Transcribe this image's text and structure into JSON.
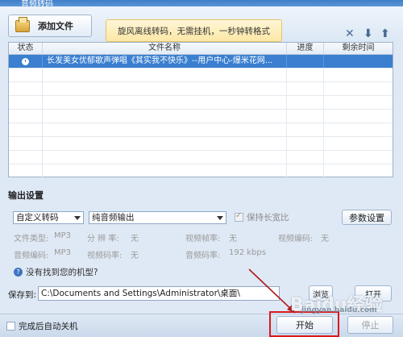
{
  "window": {
    "title": "音频转码"
  },
  "toolbar": {
    "add_file_label": "添加文件",
    "promo_text": "旋风离线转码，无需挂机，一秒钟转格式",
    "icons": [
      "close-icon",
      "move-down-icon",
      "move-up-icon"
    ]
  },
  "grid": {
    "headers": {
      "status": "状态",
      "file_name": "文件名称",
      "progress": "进度",
      "remaining": "剩余时间"
    },
    "rows": [
      {
        "status_icon": "clock-icon",
        "file_name": "长发美女优郁歌声弹唱《其实我不快乐》--用户中心-爆米花网...",
        "progress": "",
        "remaining": ""
      }
    ]
  },
  "output": {
    "section_title": "输出设置",
    "preset": "自定义转码",
    "mode": "纯音频输出",
    "keep_ratio_label": "保持长宽比",
    "param_button": "参数设置",
    "info": {
      "file_type_label": "文件类型:",
      "file_type_value": "MP3",
      "resolution_label": "分 辨 率:",
      "resolution_value": "无",
      "video_fps_label": "视频帧率:",
      "video_fps_value": "无",
      "video_codec_label": "视频编码:",
      "video_codec_value": "无",
      "audio_codec_label": "音频编码:",
      "audio_codec_value": "MP3",
      "video_bitrate_label": "视频码率:",
      "video_bitrate_value": "无",
      "audio_bitrate_label": "音频码率:",
      "audio_bitrate_value": "192 kbps"
    },
    "help_link": "没有找到您的机型?"
  },
  "save": {
    "label": "保存到:",
    "path": "C:\\Documents and Settings\\Administrator\\桌面\\",
    "browse_label": "浏览",
    "open_label": "打开"
  },
  "bottom": {
    "auto_shutdown_label": "完成后自动关机",
    "start_label": "开始",
    "stop_label": "停止"
  },
  "watermark": {
    "main": "Baidu经验",
    "sub": "jingyan.baidu.com"
  },
  "colors": {
    "selection": "#3a7fd0",
    "highlight_box": "#d9191c",
    "promo_bg": "#fbe7a6"
  }
}
